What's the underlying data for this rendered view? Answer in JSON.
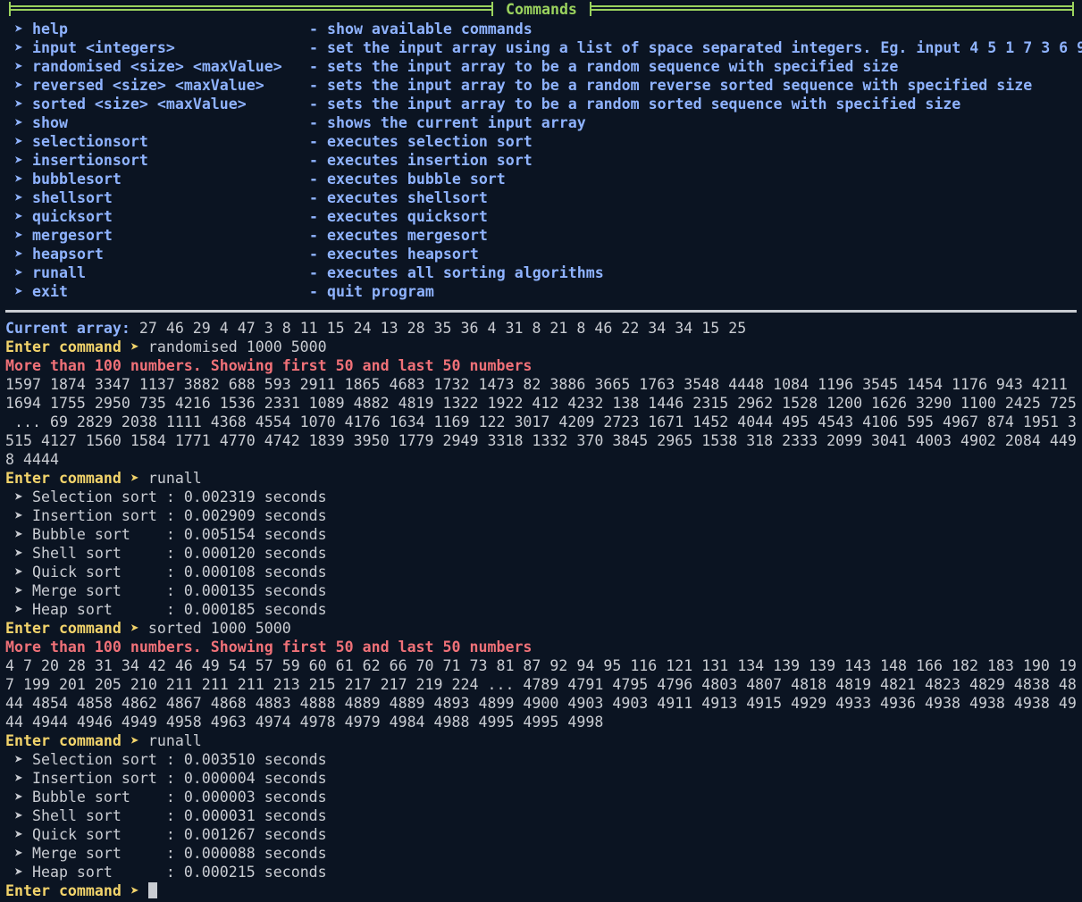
{
  "header": {
    "title": "Commands"
  },
  "commands": [
    {
      "name": "help",
      "desc": "- show available commands"
    },
    {
      "name": "input <integers>",
      "desc": "- set the input array using a list of space separated integers. Eg. input 4 5 1 7 3 6 9"
    },
    {
      "name": "randomised <size> <maxValue>",
      "desc": "- sets the input array to be a random sequence with specified size"
    },
    {
      "name": "reversed <size> <maxValue>",
      "desc": "- sets the input array to be a random reverse sorted sequence with specified size"
    },
    {
      "name": "sorted <size> <maxValue>",
      "desc": "- sets the input array to be a random sorted sequence with specified size"
    },
    {
      "name": "show",
      "desc": "- shows the current input array"
    },
    {
      "name": "selectionsort",
      "desc": "- executes selection sort"
    },
    {
      "name": "insertionsort",
      "desc": "- executes insertion sort"
    },
    {
      "name": "bubblesort",
      "desc": "- executes bubble sort"
    },
    {
      "name": "shellsort",
      "desc": "- executes shellsort"
    },
    {
      "name": "quicksort",
      "desc": "- executes quicksort"
    },
    {
      "name": "mergesort",
      "desc": "- executes mergesort"
    },
    {
      "name": "heapsort",
      "desc": "- executes heapsort"
    },
    {
      "name": "runall",
      "desc": "- executes all sorting algorithms"
    },
    {
      "name": "exit",
      "desc": "- quit program"
    }
  ],
  "chevron": "➤",
  "session": {
    "current_label": "Current array:",
    "current_values": " 27 46 29 4 47 3 8 11 15 24 13 28 35 36 4 31 8 21 8 46 22 34 34 15 25",
    "prompt_label": "Enter command ➤",
    "cmd1": " randomised 1000 5000",
    "warning": "More than 100 numbers. Showing first 50 and last 50 numbers",
    "array1": [
      "1597 1874 3347 1137 3882 688 593 2911 1865 4683 1732 1473 82 3886 3665 1763 3548 4448 1084 1196 3545 1454 1176 943 4211",
      "1694 1755 2950 735 4216 1536 2331 1089 4882 4819 1322 1922 412 4232 138 1446 2315 2962 1528 1200 1626 3290 1100 2425 725",
      " ... 69 2829 2038 1111 4368 4554 1070 4176 1634 1169 122 3017 4209 2723 1671 1452 4044 495 4543 4106 595 4967 874 1951 3",
      "515 4127 1560 1584 1771 4770 4742 1839 3950 1779 2949 3318 1332 370 3845 2965 1538 318 2333 2099 3041 4003 4902 2084 449",
      "8 4444"
    ],
    "cmd2": " runall",
    "results1": [
      "➤ Selection sort : 0.002319 seconds",
      "➤ Insertion sort : 0.002909 seconds",
      "➤ Bubble sort    : 0.005154 seconds",
      "➤ Shell sort     : 0.000120 seconds",
      "➤ Quick sort     : 0.000108 seconds",
      "➤ Merge sort     : 0.000135 seconds",
      "➤ Heap sort      : 0.000185 seconds"
    ],
    "cmd3": " sorted 1000 5000",
    "array2": [
      "4 7 20 28 31 34 42 46 49 54 57 59 60 61 62 66 70 71 73 81 87 92 94 95 116 121 131 134 139 139 143 148 166 182 183 190 19",
      "7 199 201 205 210 211 211 211 213 215 217 217 219 224 ... 4789 4791 4795 4796 4803 4807 4818 4819 4821 4823 4829 4838 48",
      "44 4854 4858 4862 4867 4868 4883 4888 4889 4889 4893 4899 4900 4903 4903 4911 4913 4915 4929 4933 4936 4938 4938 4938 49",
      "44 4944 4946 4949 4958 4963 4974 4978 4979 4984 4988 4995 4995 4998"
    ],
    "cmd4": " runall",
    "results2": [
      "➤ Selection sort : 0.003510 seconds",
      "➤ Insertion sort : 0.000004 seconds",
      "➤ Bubble sort    : 0.000003 seconds",
      "➤ Shell sort     : 0.000031 seconds",
      "➤ Quick sort     : 0.001267 seconds",
      "➤ Merge sort     : 0.000088 seconds",
      "➤ Heap sort      : 0.000215 seconds"
    ]
  },
  "colors": {
    "background": "#0b1422",
    "text": "#c9ccd2",
    "command": "#8fb3ff",
    "prompt": "#f3d46b",
    "warning": "#f07178",
    "header": "#9bd35e"
  }
}
